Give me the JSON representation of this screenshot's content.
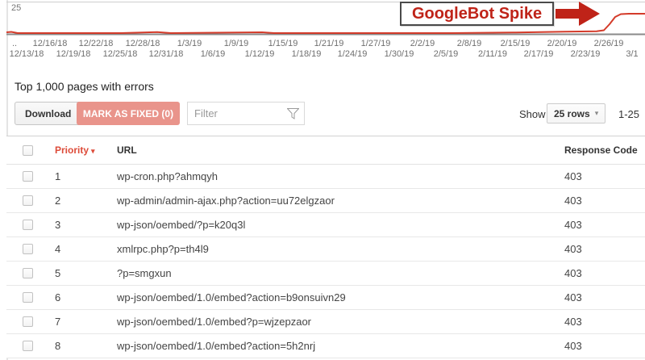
{
  "chart": {
    "y_axis_max_label": "25",
    "line_color": "#d43b2a",
    "line_points": "8,40 14,39.5 22,41 150,41 195,39.8 212,41 325,40 340,41 560,41 640,40.2 700,39.2 740,38.8 749,37.5 756,30 763,21 770,17.5 780,17 800,17",
    "annotation_text": "GoogleBot Spike",
    "x_labels_top": [
      "..",
      "12/16/18",
      "12/22/18",
      "12/28/18",
      "1/3/19",
      "1/9/19",
      "1/15/19",
      "1/21/19",
      "1/27/19",
      "2/2/19",
      "2/8/19",
      "2/15/19",
      "2/20/19",
      "2/26/19"
    ],
    "x_labels_bottom": [
      "12/13/18",
      "12/19/18",
      "12/25/18",
      "12/31/18",
      "1/6/19",
      "1/12/19",
      "1/18/19",
      "1/24/19",
      "1/30/19",
      "2/5/19",
      "2/11/19",
      "2/17/19",
      "2/23/19",
      "3/1"
    ]
  },
  "section": {
    "title": "Top 1,000 pages with errors"
  },
  "toolbar": {
    "download_label": "Download",
    "mark_fixed_label": "MARK AS FIXED (0)",
    "filter_placeholder": "Filter",
    "show_label": "Show",
    "rows_selector_value": "25 rows",
    "range_label": "1-25"
  },
  "table": {
    "headers": {
      "priority": "Priority",
      "url": "URL",
      "response_code": "Response Code"
    },
    "rows": [
      {
        "priority": "1",
        "url": "wp-cron.php?ahmqyh",
        "code": "403"
      },
      {
        "priority": "2",
        "url": "wp-admin/admin-ajax.php?action=uu72elgzaor",
        "code": "403"
      },
      {
        "priority": "3",
        "url": "wp-json/oembed/?p=k20q3l",
        "code": "403"
      },
      {
        "priority": "4",
        "url": "xmlrpc.php?p=th4l9",
        "code": "403"
      },
      {
        "priority": "5",
        "url": "?p=smgxun",
        "code": "403"
      },
      {
        "priority": "6",
        "url": "wp-json/oembed/1.0/embed?action=b9onsuivn29",
        "code": "403"
      },
      {
        "priority": "7",
        "url": "wp-json/oembed/1.0/embed?p=wjzepzaor",
        "code": "403"
      },
      {
        "priority": "8",
        "url": "wp-json/oembed/1.0/embed?action=5h2nrj",
        "code": "403"
      }
    ]
  }
}
